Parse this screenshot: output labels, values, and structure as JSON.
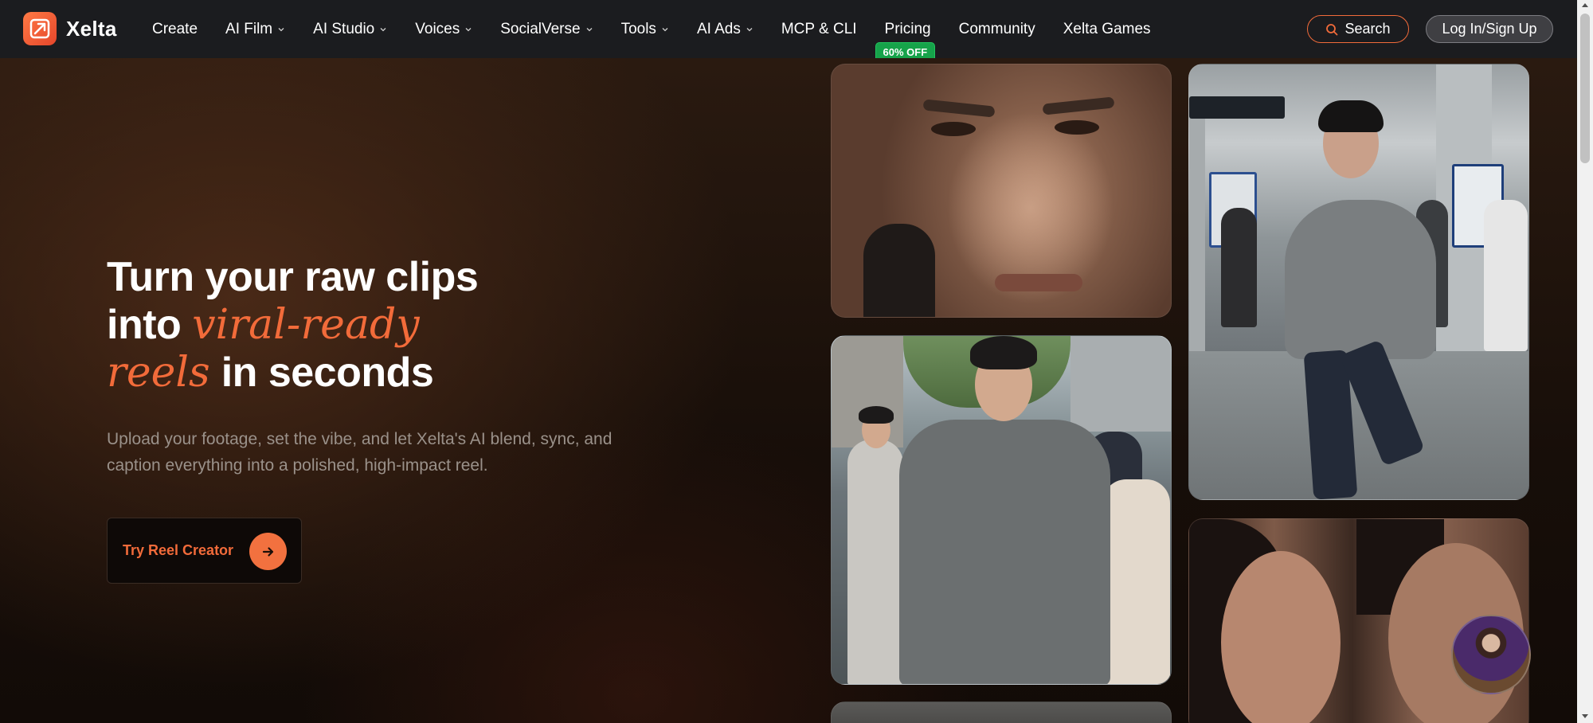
{
  "brand": {
    "name": "Xelta",
    "logo_icon": "xelta-logo-icon",
    "accent": "#f26b3a"
  },
  "nav": {
    "items": [
      {
        "label": "Create",
        "dropdown": false
      },
      {
        "label": "AI Film",
        "dropdown": true
      },
      {
        "label": "AI Studio",
        "dropdown": true
      },
      {
        "label": "Voices",
        "dropdown": true
      },
      {
        "label": "SocialVerse",
        "dropdown": true
      },
      {
        "label": "Tools",
        "dropdown": true
      },
      {
        "label": "AI Ads",
        "dropdown": true
      },
      {
        "label": "MCP & CLI",
        "dropdown": false
      },
      {
        "label": "Pricing",
        "dropdown": false,
        "badge": "60% OFF"
      },
      {
        "label": "Community",
        "dropdown": false
      },
      {
        "label": "Xelta Games",
        "dropdown": false
      }
    ],
    "search_label": "Search",
    "login_label": "Log In/Sign Up",
    "badge_color": "#16a34a"
  },
  "hero": {
    "headline_line1": "Turn your raw clips",
    "headline_line2_prefix": "into",
    "headline_accent1": "viral-ready",
    "headline_accent2": "reels",
    "headline_line3_suffix": "in seconds",
    "subtext": "Upload your footage, set the vibe, and let Xelta's AI blend, sync, and caption everything into a polished, high-impact reel.",
    "cta_label": "Try Reel Creator"
  }
}
